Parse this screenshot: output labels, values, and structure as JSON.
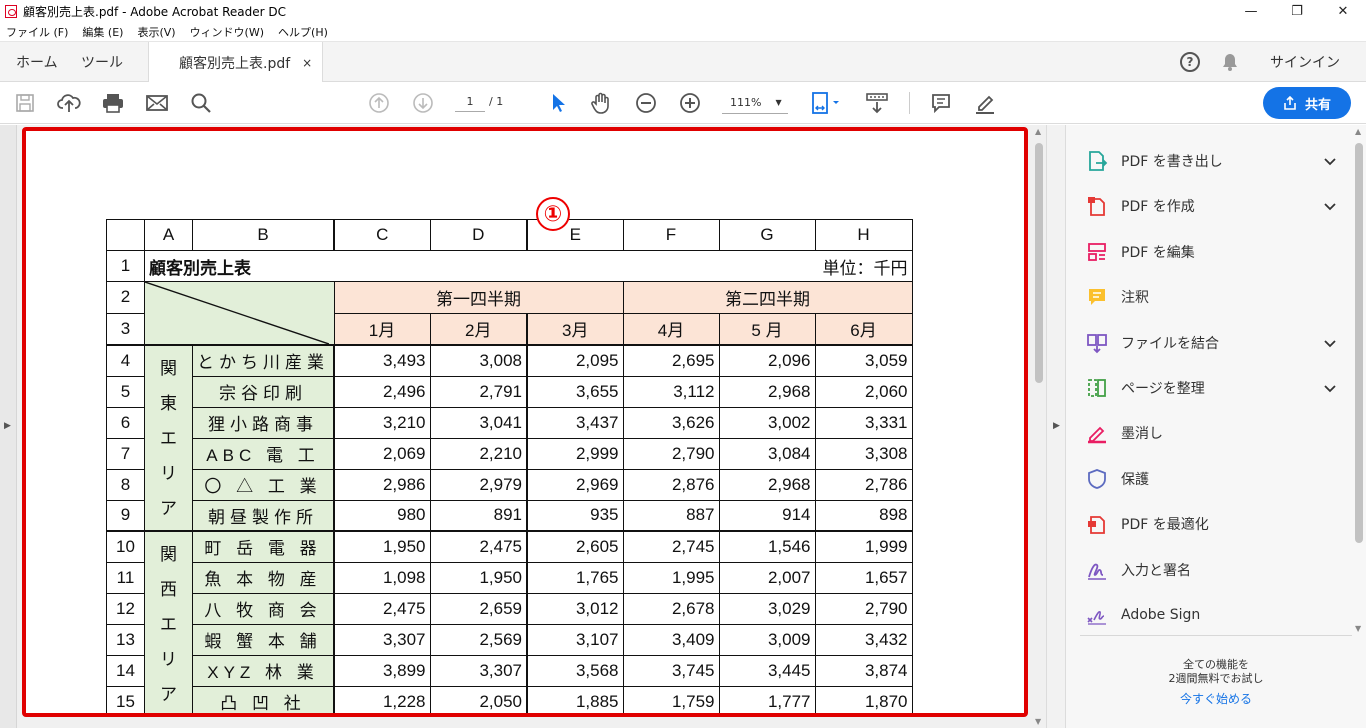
{
  "window": {
    "title": "顧客別売上表.pdf - Adobe Acrobat Reader DC",
    "minimize": "—",
    "maximize": "❐",
    "close": "✕"
  },
  "menu": [
    "ファイル (F)",
    "編集 (E)",
    "表示(V)",
    "ウィンドウ(W)",
    "ヘルプ(H)"
  ],
  "tabs": {
    "home": "ホーム",
    "tools": "ツール",
    "doc": "顧客別売上表.pdf",
    "close": "×"
  },
  "account": {
    "help": "?",
    "signin": "サインイン"
  },
  "toolbar": {
    "page_current": "1",
    "page_total": "/ 1",
    "zoom": "111%",
    "share": "共有",
    "annotation": "①"
  },
  "right_panel": {
    "items": [
      {
        "label": "PDF を書き出し",
        "icon": "export-pdf-icon",
        "chev": true,
        "color": "#26a69a"
      },
      {
        "label": "PDF を作成",
        "icon": "create-pdf-icon",
        "chev": true,
        "color": "#e53935"
      },
      {
        "label": "PDF を編集",
        "icon": "edit-pdf-icon",
        "chev": false,
        "color": "#e91e63"
      },
      {
        "label": "注釈",
        "icon": "comment-icon",
        "chev": false,
        "color": "#fbc02d"
      },
      {
        "label": "ファイルを結合",
        "icon": "combine-files-icon",
        "chev": true,
        "color": "#7e57c2"
      },
      {
        "label": "ページを整理",
        "icon": "organize-pages-icon",
        "chev": true,
        "color": "#43a047"
      },
      {
        "label": "墨消し",
        "icon": "redact-icon",
        "chev": false,
        "color": "#e91e63"
      },
      {
        "label": "保護",
        "icon": "protect-icon",
        "chev": false,
        "color": "#5c6bc0"
      },
      {
        "label": "PDF を最適化",
        "icon": "optimize-pdf-icon",
        "chev": false,
        "color": "#e53935"
      },
      {
        "label": "入力と署名",
        "icon": "fill-sign-icon",
        "chev": false,
        "color": "#7e57c2"
      },
      {
        "label": "Adobe Sign",
        "icon": "adobe-sign-icon",
        "chev": false,
        "color": "#7e57c2"
      }
    ],
    "promo_line1": "全ての機能を",
    "promo_line2": "2週間無料でお試し",
    "promo_link": "今すぐ始める"
  },
  "sheet": {
    "col_headers": [
      "A",
      "B",
      "C",
      "D",
      "E",
      "F",
      "G",
      "H"
    ],
    "title": "顧客別売上表",
    "unit": "単位：千円",
    "q1": "第一四半期",
    "q2": "第二四半期",
    "months": [
      "1月",
      "2月",
      "3月",
      "4月",
      "5 月",
      "6月"
    ],
    "areas": [
      {
        "name": "関東エリア",
        "chars": [
          "関",
          "東",
          "エ",
          "リ",
          "ア"
        ]
      },
      {
        "name": "関西エリア",
        "chars": [
          "関",
          "西",
          "エ",
          "リ",
          "ア"
        ]
      }
    ],
    "rows": [
      {
        "n": "4",
        "company": "とかち川産業",
        "v": [
          "3,493",
          "3,008",
          "2,095",
          "2,695",
          "2,096",
          "3,059"
        ]
      },
      {
        "n": "5",
        "company": "宗谷印刷",
        "v": [
          "2,496",
          "2,791",
          "3,655",
          "3,112",
          "2,968",
          "2,060"
        ]
      },
      {
        "n": "6",
        "company": "狸小路商事",
        "v": [
          "3,210",
          "3,041",
          "3,437",
          "3,626",
          "3,002",
          "3,331"
        ]
      },
      {
        "n": "7",
        "company": "ABC 電 工",
        "v": [
          "2,069",
          "2,210",
          "2,999",
          "2,790",
          "3,084",
          "3,308"
        ]
      },
      {
        "n": "8",
        "company": "〇 △ 工 業",
        "v": [
          "2,986",
          "2,979",
          "2,969",
          "2,876",
          "2,968",
          "2,786"
        ]
      },
      {
        "n": "9",
        "company": "朝昼製作所",
        "v": [
          "980",
          "891",
          "935",
          "887",
          "914",
          "898"
        ]
      },
      {
        "n": "10",
        "company": "町 岳 電 器",
        "v": [
          "1,950",
          "2,475",
          "2,605",
          "2,745",
          "1,546",
          "1,999"
        ]
      },
      {
        "n": "11",
        "company": "魚 本 物 産",
        "v": [
          "1,098",
          "1,950",
          "1,765",
          "1,995",
          "2,007",
          "1,657"
        ]
      },
      {
        "n": "12",
        "company": "八 牧 商 会",
        "v": [
          "2,475",
          "2,659",
          "3,012",
          "2,678",
          "3,029",
          "2,790"
        ]
      },
      {
        "n": "13",
        "company": "蝦 蟹 本 舗",
        "v": [
          "3,307",
          "2,569",
          "3,107",
          "3,409",
          "3,009",
          "3,432"
        ]
      },
      {
        "n": "14",
        "company": "XYZ 林 業",
        "v": [
          "3,899",
          "3,307",
          "3,568",
          "3,745",
          "3,445",
          "3,874"
        ]
      },
      {
        "n": "15",
        "company": "凸 凹 社",
        "v": [
          "1,228",
          "2,050",
          "1,885",
          "1,759",
          "1,777",
          "1,870"
        ]
      }
    ]
  }
}
